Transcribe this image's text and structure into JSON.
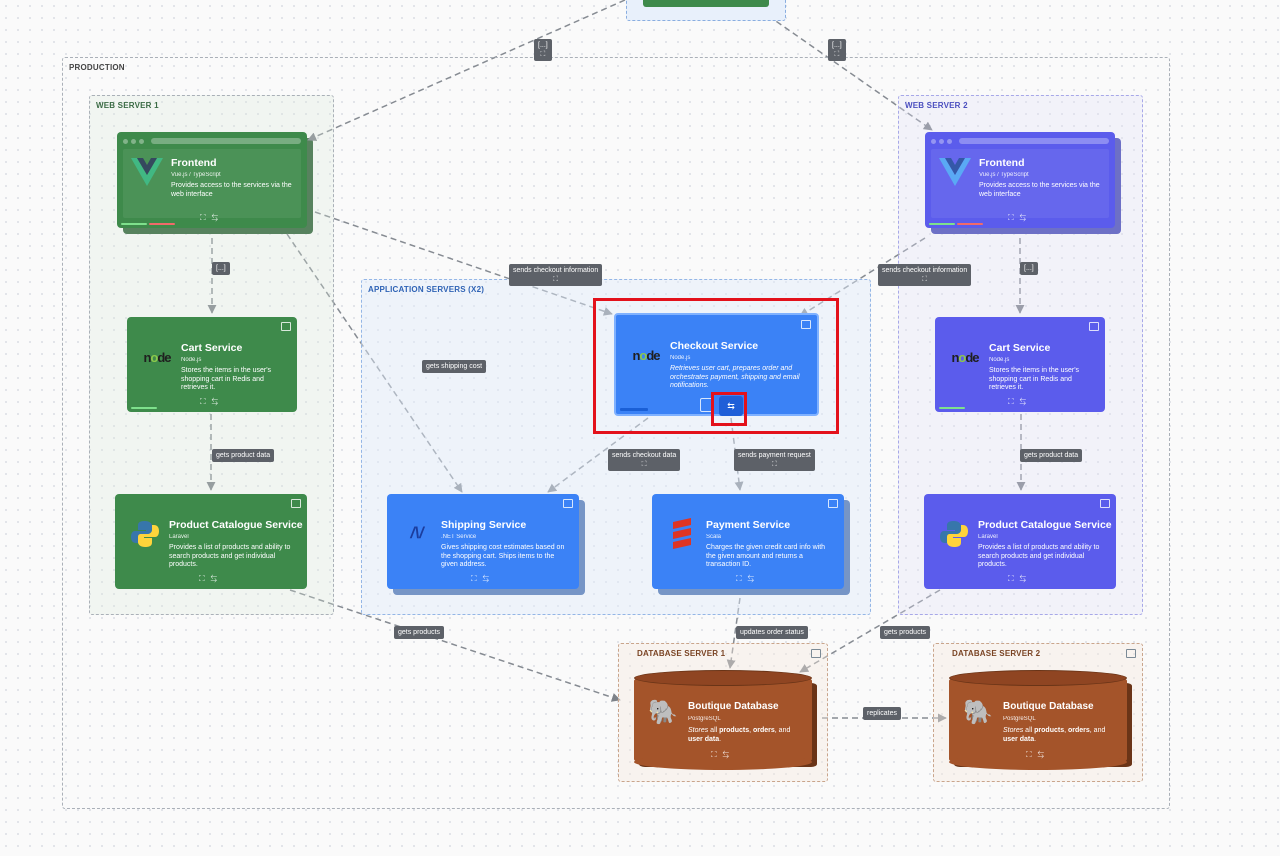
{
  "boundaries": {
    "production": "PRODUCTION",
    "web_server_1": "WEB SERVER 1",
    "web_server_2": "WEB SERVER 2",
    "app_servers": "APPLICATION SERVERS (X2)",
    "db_server_1": "DATABASE SERVER 1",
    "db_server_2": "DATABASE SERVER 2"
  },
  "frontend": {
    "name": "Frontend",
    "tech": "Vue.js / TypeScript",
    "desc": "Provides access to the services via the web interface",
    "icon": "vue-logo-icon"
  },
  "cart": {
    "name": "Cart Service",
    "tech": "Node.js",
    "desc": "Stores the items in the user's shopping cart in Redis and retrieves it.",
    "icon": "nodejs-logo-icon"
  },
  "catalogue": {
    "name": "Product Catalogue Service",
    "tech": "Laravel",
    "desc": "Provides a list of products and ability to search products and get individual products.",
    "icon": "python-logo-icon"
  },
  "checkout": {
    "name": "Checkout Service",
    "tech": "Node.js",
    "desc": "Retrieves user cart, prepares order and orchestrates payment, shipping and email notifications.",
    "icon": "nodejs-logo-icon"
  },
  "shipping": {
    "name": "Shipping Service",
    "tech": ".NET Service",
    "desc": "Gives shipping cost estimates based on the shopping cart. Ships items to the given address.",
    "icon": "dotnet-logo-icon"
  },
  "payment": {
    "name": "Payment Service",
    "tech": "Scala",
    "desc": "Charges the given credit card info with the given amount and returns a transaction ID.",
    "icon": "scala-logo-icon"
  },
  "database": {
    "name": "Boutique Database",
    "tech": "PostgreSQL",
    "desc_prefix": "Stores",
    "desc_mid1": " all ",
    "desc_b1": "products",
    "desc_mid2": ", ",
    "desc_b2": "orders",
    "desc_mid3": ", and ",
    "desc_b3": "user data",
    "desc_end": ".",
    "icon": "postgresql-logo-icon"
  },
  "edge_labels": {
    "ellipsis": "[...]",
    "sends_checkout_information": "sends checkout information",
    "gets_shipping_cost": "gets shipping cost",
    "gets_product_data": "gets product data",
    "sends_checkout_data": "sends checkout data",
    "sends_payment_request": "sends payment request",
    "gets_products": "gets products",
    "updates_order_status": "updates order status",
    "replicates": "replicates"
  },
  "colors": {
    "green": "#3e8a4b",
    "green_dark": "#245a2e",
    "blue": "#3b82f6",
    "blue_dark": "#1f4f9c",
    "indigo": "#6366f1",
    "indigo_dark": "#3b3fb0",
    "brown": "#a4542a",
    "brown_dark": "#6a3417",
    "highlight": "#e3111b"
  },
  "selection": {
    "highlighted_node": "Checkout Service",
    "highlighted_action": "compare-icon"
  }
}
